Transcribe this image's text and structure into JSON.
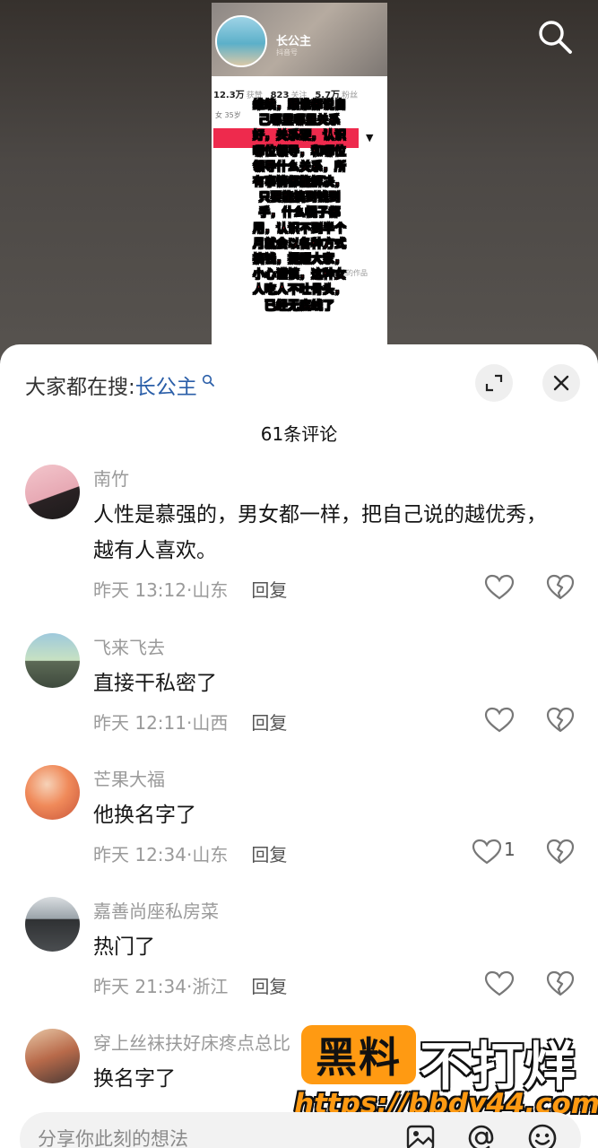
{
  "video": {
    "username": "长公主",
    "subtitle": "抖音号",
    "stats": [
      {
        "value": "12.3万",
        "label": "获赞"
      },
      {
        "value": "823",
        "label": "关注"
      },
      {
        "value": "5.7万",
        "label": "粉丝"
      }
    ],
    "profile_line": "女 35岁",
    "gray_text": "可以看到她的作品",
    "overlay_lines": [
      "维续，跟谁都说自",
      "己哪里哪里关系",
      "好，关系硬，认识",
      "哪位领导，和哪位",
      "领导什么关系，所",
      "有事情都能解决，",
      "只要能搞到钱到",
      "手，什么幌子都",
      "用，认识不到半个",
      "月就会以各种方式",
      "搞钱，提醒大家，",
      "小心谨慎，这种女",
      "人吃人不吐骨头，",
      "已经无底线了"
    ]
  },
  "sheet": {
    "search_prefix": "大家都在搜:",
    "search_keyword": "长公主",
    "comment_count_title": "61条评论",
    "input_placeholder": "分享你此刻的想法"
  },
  "comments": [
    {
      "name": "南竹",
      "text": "人性是慕强的，男女都一样，把自己说的越优秀，越有人喜欢。",
      "time": "昨天 13:12",
      "location": "山东",
      "reply": "回复",
      "likes": ""
    },
    {
      "name": "飞来飞去",
      "text": "直接干私密了",
      "time": "昨天 12:11",
      "location": "山西",
      "reply": "回复",
      "likes": ""
    },
    {
      "name": "芒果大福",
      "text": "他换名字了",
      "time": "昨天 12:34",
      "location": "山东",
      "reply": "回复",
      "likes": "1"
    },
    {
      "name": "嘉善尚座私房菜",
      "text": "热门了",
      "time": "昨天 21:34",
      "location": "浙江",
      "reply": "回复",
      "likes": ""
    },
    {
      "name": "穿上丝袜扶好床疼点总比",
      "text": "换名字了",
      "time": "",
      "location": "",
      "reply": "",
      "likes": ""
    }
  ],
  "watermark": {
    "box_text": "黑料",
    "text": "不打烊",
    "url": "https://bbdy44.com"
  },
  "colors": {
    "accent_link": "#2a5ea8",
    "overlay_red": "#ff1e2e",
    "watermark_orange": "#ff9a12"
  },
  "icons": [
    "search-icon",
    "expand-icon",
    "close-icon",
    "heart-icon",
    "broken-heart-icon",
    "image-icon",
    "at-icon",
    "emoji-icon"
  ]
}
